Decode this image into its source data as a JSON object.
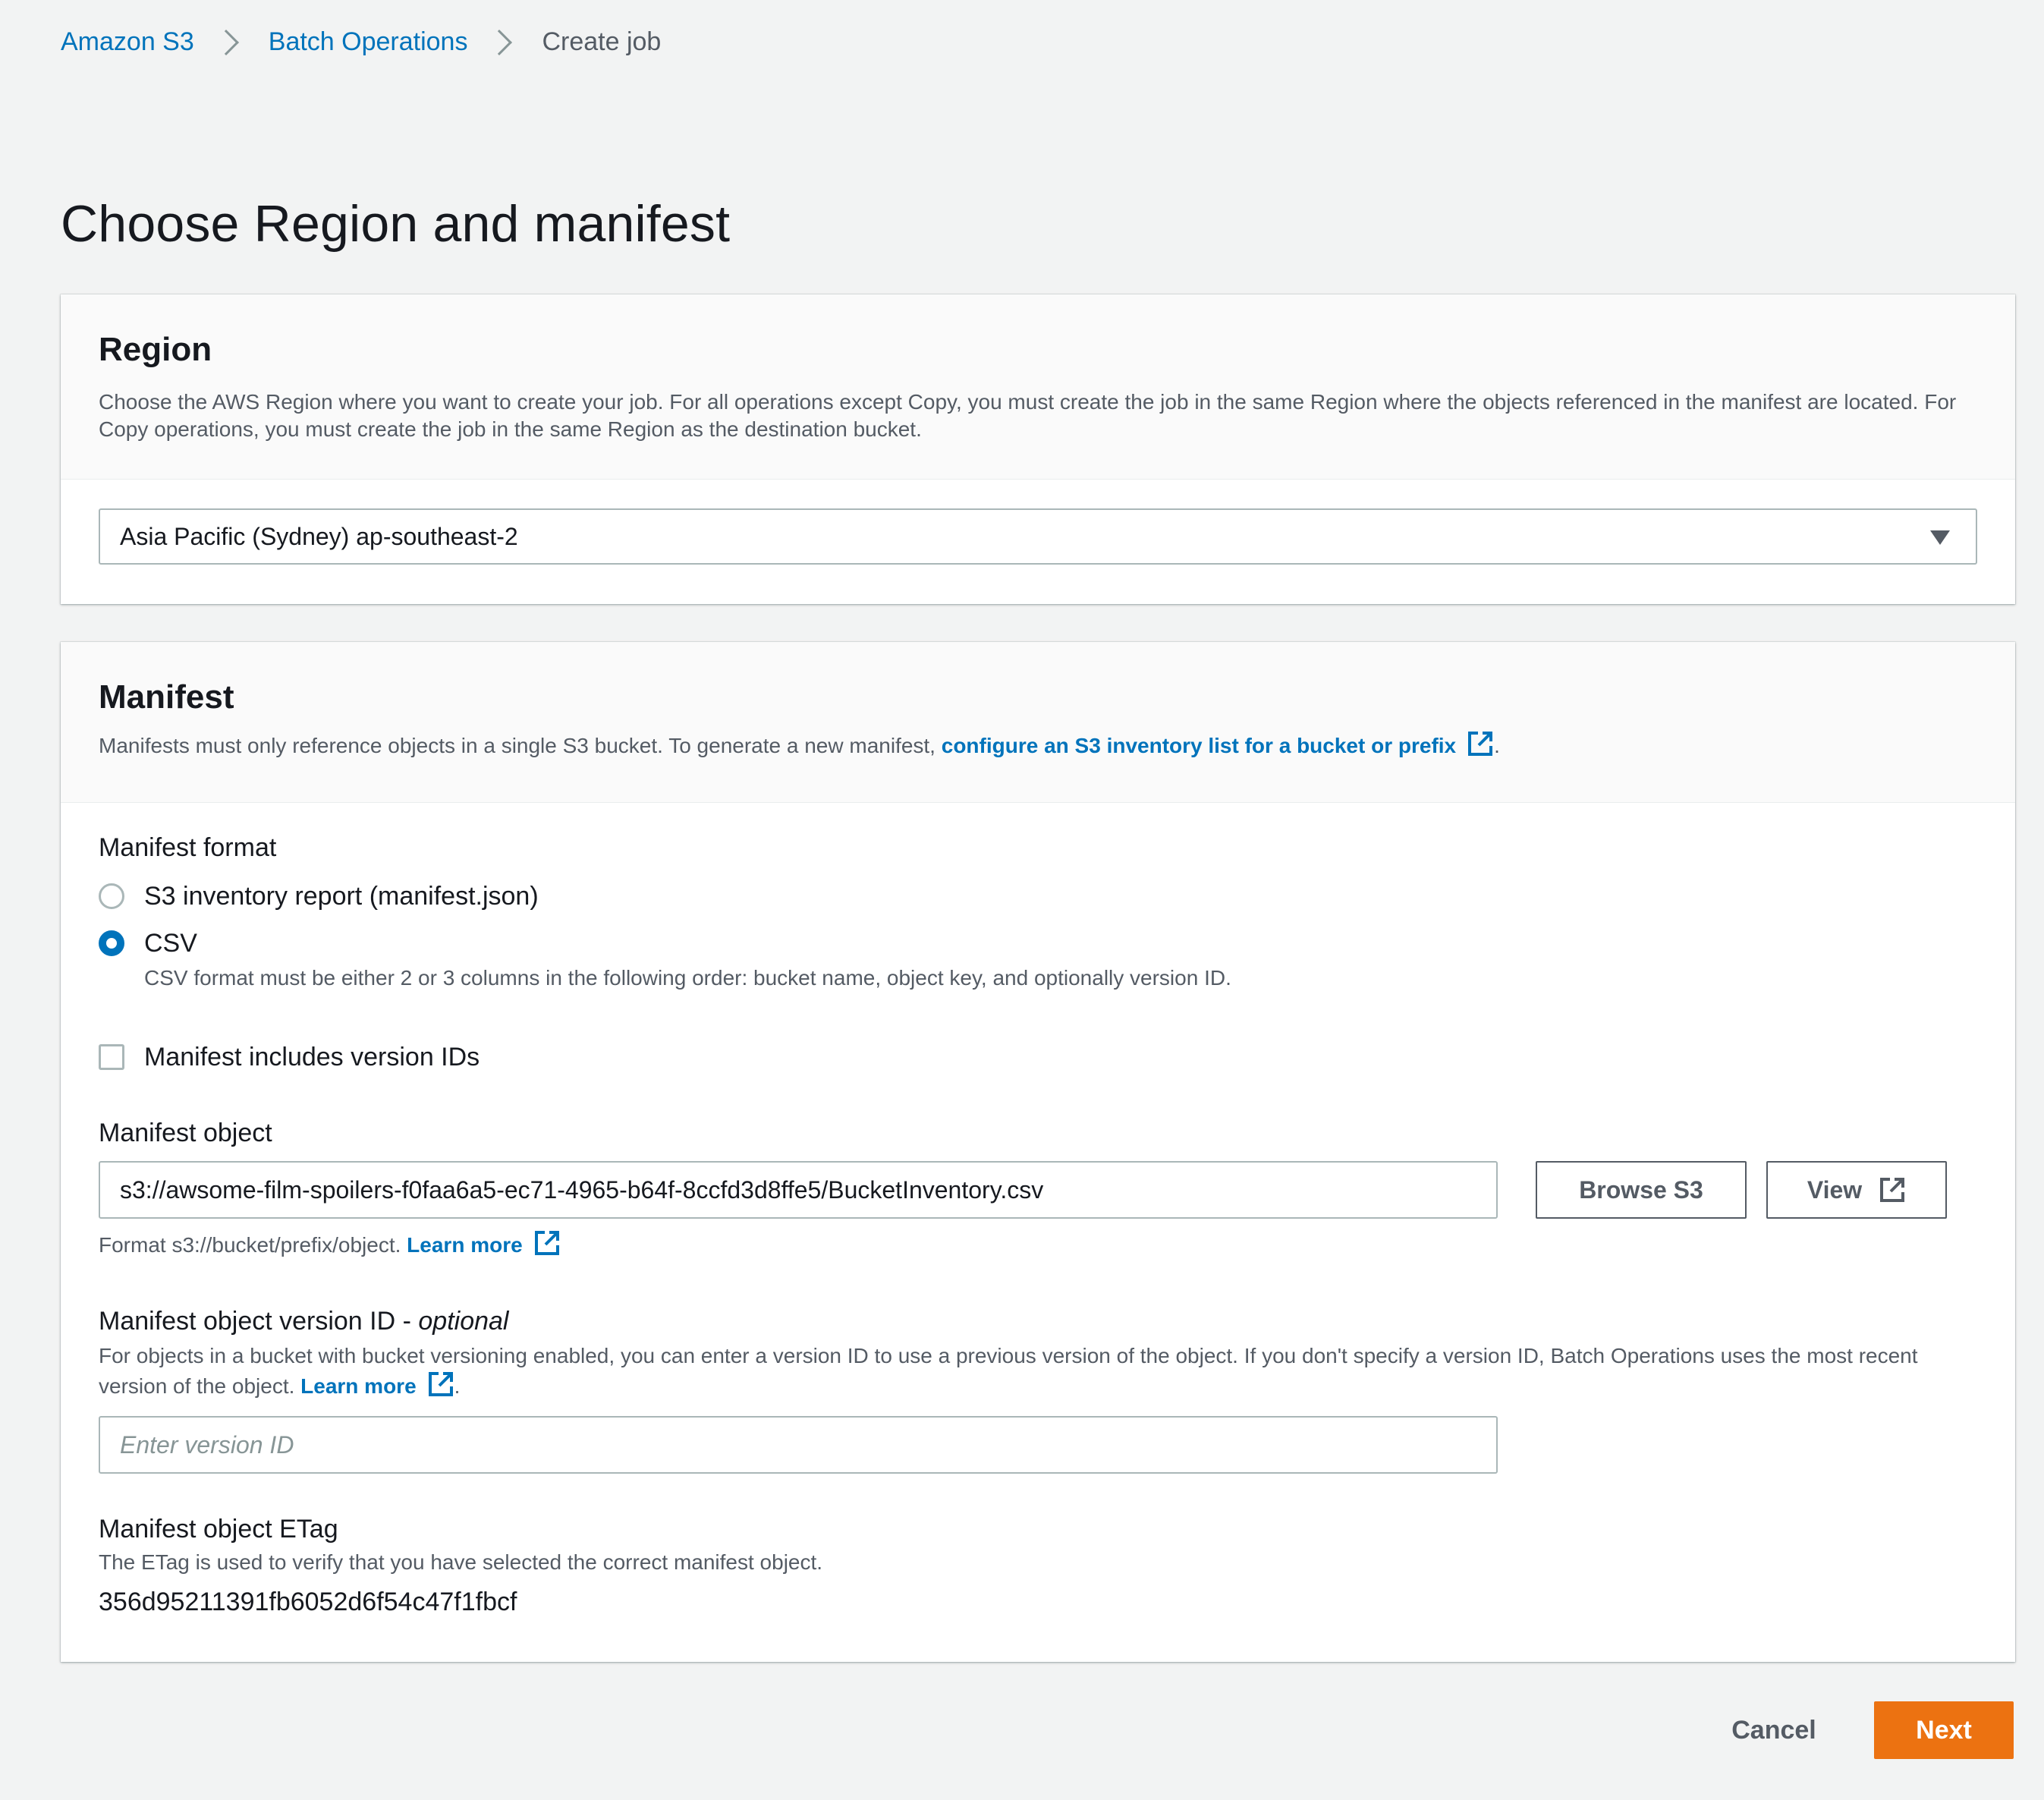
{
  "breadcrumb": {
    "items": [
      {
        "label": "Amazon S3"
      },
      {
        "label": "Batch Operations"
      },
      {
        "label": "Create job"
      }
    ]
  },
  "page_title": "Choose Region and manifest",
  "region": {
    "title": "Region",
    "description": "Choose the AWS Region where you want to create your job. For all operations except Copy, you must create the job in the same Region where the objects referenced in the manifest are located. For Copy operations, you must create the job in the same Region as the destination bucket.",
    "selected": "Asia Pacific (Sydney) ap-southeast-2"
  },
  "manifest": {
    "title": "Manifest",
    "description_prefix": "Manifests must only reference objects in a single S3 bucket. To generate a new manifest, ",
    "description_link": "configure an S3 inventory list for a bucket or prefix",
    "description_suffix": ".",
    "format_label": "Manifest format",
    "format_options": [
      {
        "label": "S3 inventory report (manifest.json)",
        "checked": false
      },
      {
        "label": "CSV",
        "checked": true,
        "description": "CSV format must be either 2 or 3 columns in the following order: bucket name, object key, and optionally version ID."
      }
    ],
    "version_ids_checkbox": {
      "label": "Manifest includes version IDs",
      "checked": false
    },
    "object": {
      "label": "Manifest object",
      "value": "s3://awsome-film-spoilers-f0faa6a5-ec71-4965-b64f-8ccfd3d8ffe5/BucketInventory.csv",
      "browse_label": "Browse S3",
      "view_label": "View",
      "hint": "Format s3://bucket/prefix/object.",
      "learn_more": "Learn more"
    },
    "version_id": {
      "label": "Manifest object version ID",
      "optional": "optional",
      "description": "For objects in a bucket with bucket versioning enabled, you can enter a version ID to use a previous version of the object. If you don't specify a version ID, Batch Operations uses the most recent version of the object.",
      "learn_more": "Learn more",
      "suffix": ".",
      "placeholder": "Enter version ID"
    },
    "etag": {
      "label": "Manifest object ETag",
      "description": "The ETag is used to verify that you have selected the correct manifest object.",
      "value": "356d95211391fb6052d6f54c47f1fbcf"
    }
  },
  "actions": {
    "cancel": "Cancel",
    "next": "Next"
  },
  "colors": {
    "link": "#0073bb",
    "primary": "#ec7211",
    "background": "#f2f3f3"
  }
}
